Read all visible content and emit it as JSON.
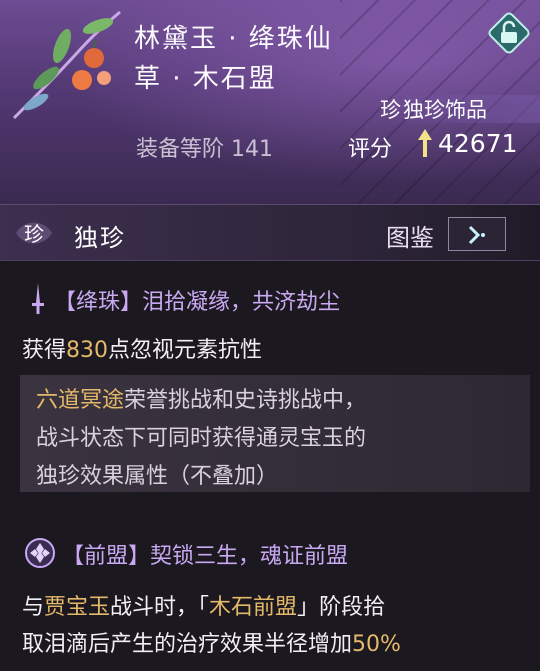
{
  "item": {
    "name": "林黛玉 · 绛珠仙",
    "subtitle": "草 · 木石盟",
    "rarity_badge": "珍",
    "rarity_label": "独珍饰品",
    "gear_level_label": "装备等阶",
    "gear_level_value": "141",
    "score_label": "评分",
    "score_value": "42671"
  },
  "section": {
    "badge": "珍",
    "title": "独珍",
    "codex_label": "图鉴"
  },
  "effect1": {
    "name": "【绛珠】泪拾凝缘，共济劫尘",
    "line_prefix": "获得",
    "line_value": "830",
    "line_suffix": "点忽视元素抗性"
  },
  "note": {
    "highlight": "六道冥途",
    "line1_rest": "荣誉挑战和史诗挑战中，",
    "line2": "战斗状态下可同时获得通灵宝玉的",
    "line3": "独珍效果属性（不叠加）"
  },
  "effect2": {
    "name": "【前盟】契锁三生，魂证前盟",
    "l1_a": "与",
    "l1_b": "贾宝玉",
    "l1_c": "战斗时，「",
    "l1_d": "木石前盟",
    "l1_e": "」阶段拾",
    "l2_a": "取泪滴后产生的治疗效果半径增加",
    "l2_b": "50%"
  },
  "colors": {
    "gold": "#e4b96a",
    "accent_purple": "#c8a9f2",
    "lock_teal": "#6fd0c4"
  }
}
